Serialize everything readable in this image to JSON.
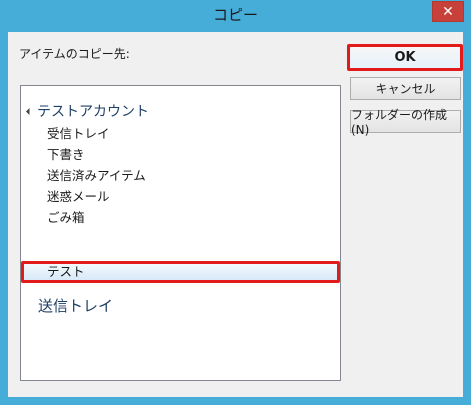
{
  "window": {
    "title": "コピー",
    "close_glyph": "✕"
  },
  "dialog": {
    "destination_label": "アイテムのコピー先:",
    "folder_tree": {
      "root_label": "テストアカウント",
      "items": [
        {
          "label": "受信トレイ"
        },
        {
          "label": "下書き"
        },
        {
          "label": "送信済みアイテム"
        },
        {
          "label": "迷惑メール"
        },
        {
          "label": "ごみ箱"
        },
        {
          "label": "テスト",
          "selected": true
        }
      ],
      "outbox_label": "送信トレイ"
    },
    "buttons": {
      "ok": "OK",
      "cancel": "キャンセル",
      "new_folder": "フォルダーの作成(N)"
    }
  },
  "colors": {
    "title_bar": "#46acd8",
    "close_button": "#c7413a",
    "highlight": "#e31a1a",
    "root_text": "#1e3f66"
  }
}
